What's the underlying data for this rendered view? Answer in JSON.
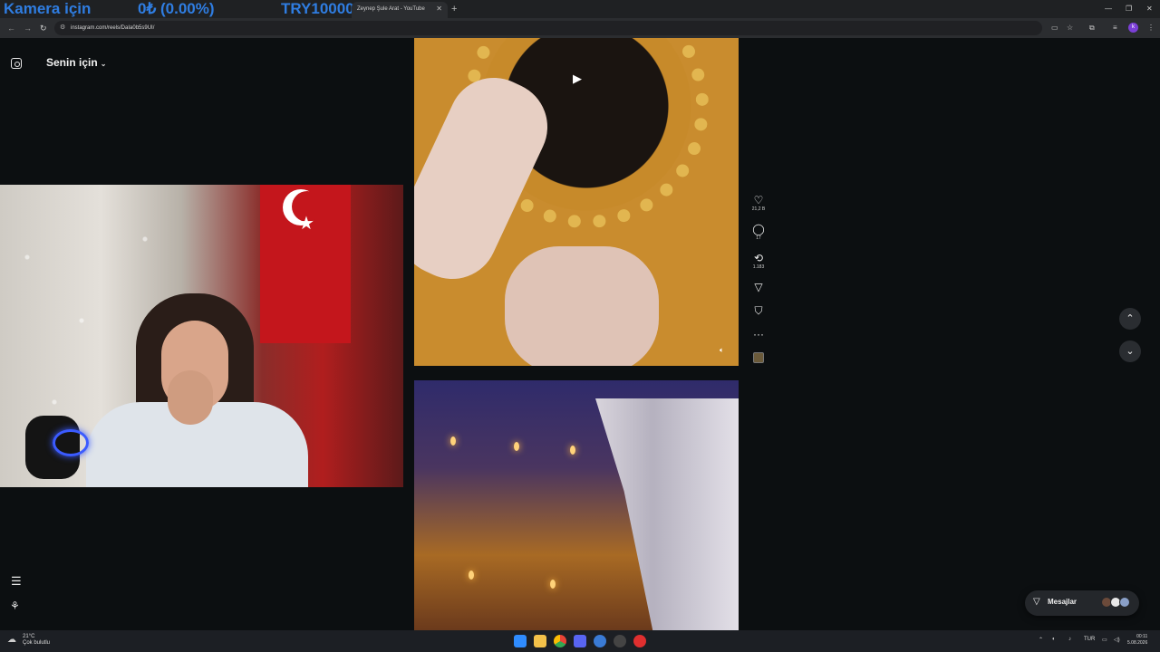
{
  "overlay": {
    "camera_label": "Kamera için",
    "balance": "0₺ (0.00%)",
    "goal": "TRY10000"
  },
  "browser": {
    "tab_title": "Zeynep Şule Arat - YouTube",
    "url": "instagram.com/reels/DaIa0b5s9UI/",
    "profile_initial": "k"
  },
  "page": {
    "feed_title": "Senin için"
  },
  "actions": {
    "likes": "21,2 B",
    "comments": "17",
    "reposts": "1.183"
  },
  "messages": {
    "label": "Mesajlar"
  },
  "taskbar": {
    "temperature": "21°C",
    "weather": "Çok bulutlu",
    "lang": "TUR",
    "time": "00:11",
    "date": "5.08.2026"
  },
  "colors": {
    "page_bg": "#0c0f11",
    "overlay_text": "#2f7de1",
    "profile": "#7b3fd6"
  },
  "icons": [
    "instagram-icon",
    "chevron-down-icon",
    "heart-icon",
    "comment-icon",
    "repost-icon",
    "send-icon",
    "bookmark-icon",
    "more-icon",
    "play-icon",
    "volume-icon",
    "arrow-up-icon",
    "arrow-down-icon",
    "menu-icon",
    "threads-icon",
    "message-icon"
  ]
}
